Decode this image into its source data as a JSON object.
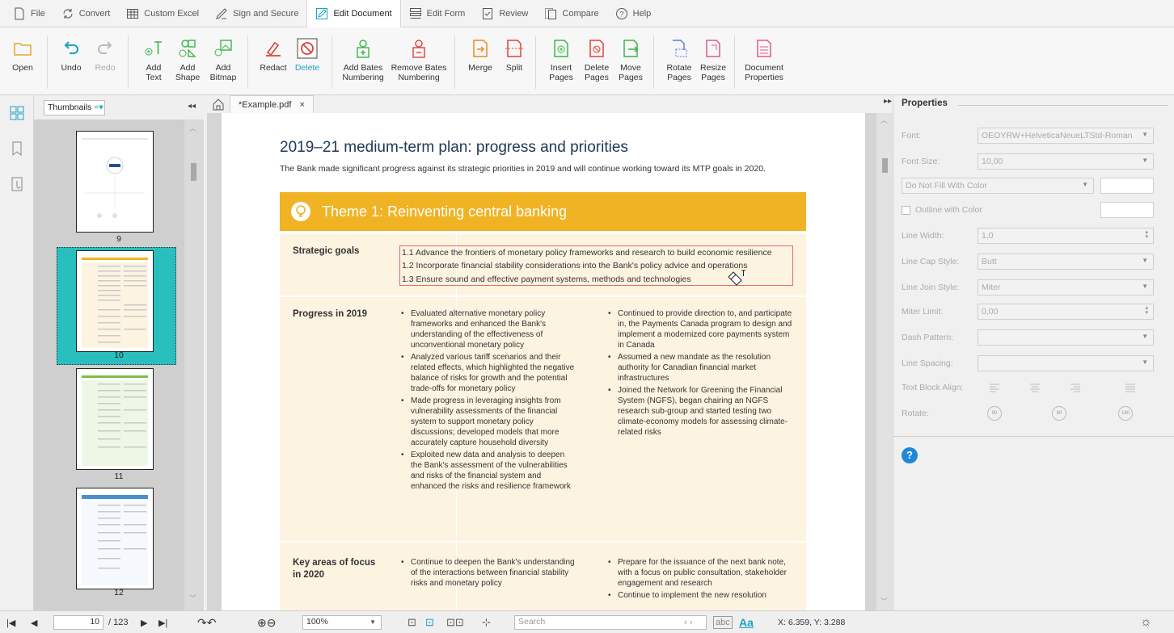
{
  "colors": {
    "accent": "#1ba1c2",
    "theme_band": "#f0b323",
    "row_bg": "#fdf3e1",
    "selection": "#29bfbf",
    "goal_box": "#e56b6b"
  },
  "menu": {
    "items": [
      {
        "label": "File",
        "icon": "document-icon"
      },
      {
        "label": "Convert",
        "icon": "convert-icon"
      },
      {
        "label": "Custom Excel",
        "icon": "table-icon"
      },
      {
        "label": "Sign and Secure",
        "icon": "pen-sign-icon"
      },
      {
        "label": "Edit Document",
        "icon": "edit-document-icon",
        "active": true
      },
      {
        "label": "Edit Form",
        "icon": "form-icon"
      },
      {
        "label": "Review",
        "icon": "review-icon"
      },
      {
        "label": "Compare",
        "icon": "compare-icon"
      },
      {
        "label": "Help",
        "icon": "help-icon"
      }
    ]
  },
  "ribbon": {
    "open": "Open",
    "undo": "Undo",
    "redo": "Redo",
    "add_text": "Add\nText",
    "add_shape": "Add\nShape",
    "add_bitmap": "Add\nBitmap",
    "redact": "Redact",
    "delete": "Delete",
    "add_bates": "Add Bates\nNumbering",
    "remove_bates": "Remove Bates\nNumbering",
    "merge": "Merge",
    "split": "Split",
    "insert_pages": "Insert\nPages",
    "delete_pages": "Delete\nPages",
    "move_pages": "Move\nPages",
    "rotate_pages": "Rotate\nPages",
    "resize_pages": "Resize\nPages",
    "doc_props": "Document\nProperties"
  },
  "sidebar": {
    "dropdown": "Thumbnails",
    "pages": [
      "9",
      "10",
      "11",
      "12"
    ],
    "selected_page": "10"
  },
  "tab": {
    "label": "*Example.pdf",
    "close": "×"
  },
  "document": {
    "title": "2019–21 medium-term plan: progress and priorities",
    "intro": "The Bank made significant progress against its strategic priorities in 2019 and will continue working toward its MTP goals in 2020.",
    "theme_title": "Theme 1: Reinventing central banking",
    "strategic_goals_label": "Strategic goals",
    "goals": [
      "1.1 Advance the frontiers of monetary policy frameworks and research to build economic resilience",
      "1.2 Incorporate financial stability considerations into the Bank's policy advice and operations",
      "1.3 Ensure sound and effective payment systems, methods and technologies"
    ],
    "progress_label": "Progress in 2019",
    "progress_left": [
      "Evaluated alternative monetary policy frameworks and enhanced the Bank's understanding of the effectiveness of unconventional monetary policy",
      "Analyzed various tariff scenarios and their related effects, which highlighted the negative balance of risks for growth and the potential trade-offs for monetary policy",
      "Made progress in leveraging insights from vulnerability assessments of the financial system to support monetary policy discussions; developed models that more accurately capture household diversity",
      "Exploited new data and analysis to deepen the Bank's assessment of the vulnerabilities and risks of the financial system and enhanced the risks and resilience framework"
    ],
    "progress_right": [
      "Continued to provide direction to, and participate in, the Payments Canada program to design and implement a modernized core payments system in Canada",
      "Assumed a new mandate as the resolution authority for Canadian financial market infrastructures",
      "Joined the Network for Greening the Financial System (NGFS), began chairing an NGFS research sub-group and started testing two climate-economy models for assessing climate-related risks"
    ],
    "focus_label": "Key areas of focus in 2020",
    "focus_left": [
      "Continue to deepen the Bank's understanding of the interactions between financial stability risks and monetary policy"
    ],
    "focus_right": [
      "Prepare for the issuance of the next bank note, with a focus on public consultation, stakeholder engagement and research",
      "Continue to implement the new resolution"
    ]
  },
  "properties": {
    "title": "Properties",
    "font_label": "Font:",
    "font_value": "OEOYRW+HelveticaNeueLTStd-Roman",
    "font_size_label": "Font Size:",
    "font_size_value": "10,00",
    "fill": "Do Not Fill With Color",
    "outline": "Outline with Color",
    "line_width_label": "Line Width:",
    "line_width_value": "1,0",
    "line_cap_label": "Line Cap Style:",
    "line_cap_value": "Butt",
    "line_join_label": "Line Join Style:",
    "line_join_value": "Miter",
    "miter_label": "Miter Limit:",
    "miter_value": "0,00",
    "dash_label": "Dash Pattern:",
    "spacing_label": "Line Spacing:",
    "align_label": "Text Block Align:",
    "rotate_label": "Rotate:",
    "rot_values": [
      "90",
      "90",
      "180"
    ]
  },
  "status": {
    "page_current": "10",
    "page_total": "/ 123",
    "zoom": "100%",
    "search_placeholder": "Search",
    "match_case": "abc",
    "font_case": "Aa",
    "coords": "X: 6.359, Y: 3.288"
  }
}
